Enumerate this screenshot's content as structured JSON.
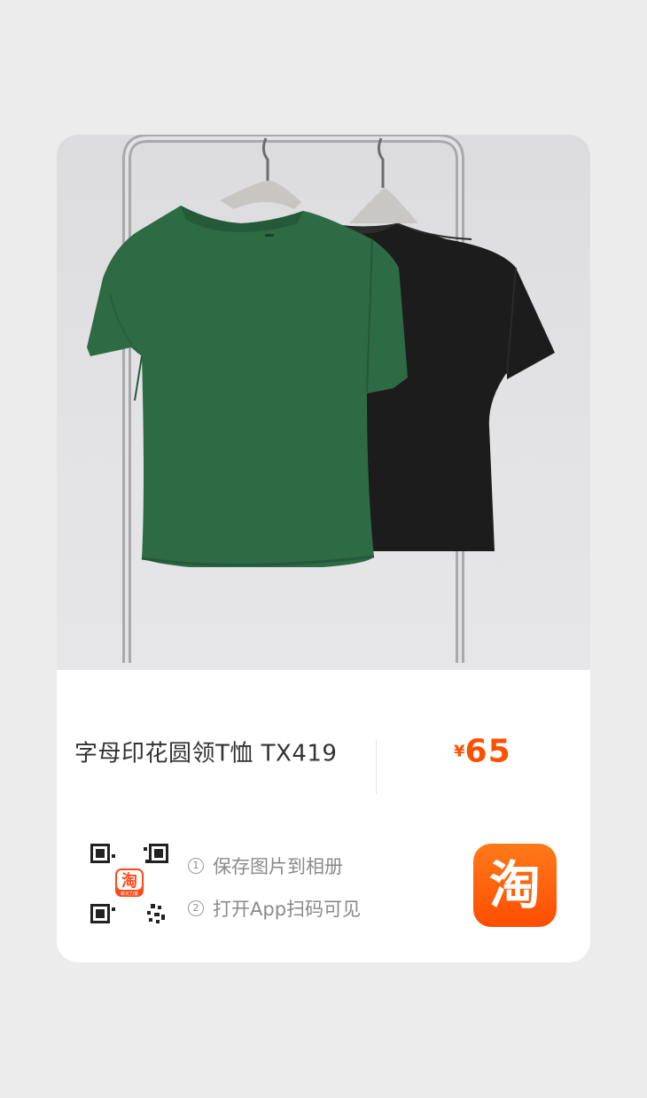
{
  "product": {
    "title": "字母印花圆领T恤 TX419",
    "price_currency": "¥",
    "price_value": "65"
  },
  "steps": [
    {
      "num": "1",
      "text": "保存图片到相册"
    },
    {
      "num": "2",
      "text": "打开App扫码可见"
    }
  ],
  "qr": {
    "center_logo_char": "淘",
    "center_logo_caption": "新天力量"
  },
  "app_icon": {
    "char": "淘"
  },
  "colors": {
    "accent": "#ff5000",
    "card_bg": "#ffffff",
    "page_bg": "#ececec",
    "shirt_green": "#2e6e45",
    "shirt_black": "#1b1b1b"
  }
}
